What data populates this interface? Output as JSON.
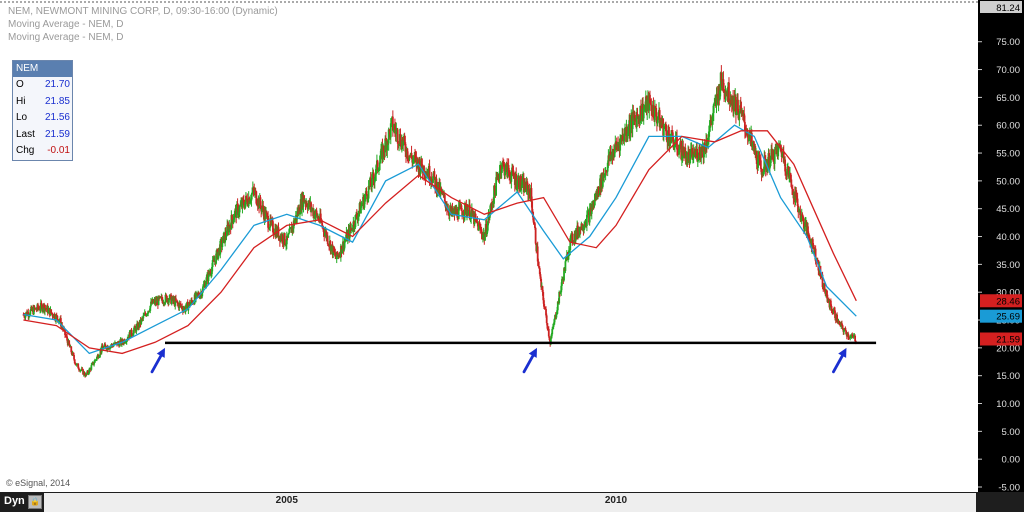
{
  "header": {
    "line1": "NEM, NEWMONT MINING CORP, D, 09:30-16:00 (Dynamic)",
    "line2": "Moving Average - NEM, D",
    "line3": "Moving Average - NEM, D"
  },
  "legend": {
    "symbol": "NEM",
    "rows": [
      {
        "label": "O",
        "value": "21.70"
      },
      {
        "label": "Hi",
        "value": "21.85"
      },
      {
        "label": "Lo",
        "value": "21.56"
      },
      {
        "label": "Last",
        "value": "21.59"
      },
      {
        "label": "Chg",
        "value": "-0.01"
      }
    ]
  },
  "copyright": "© eSignal, 2014",
  "bottom": {
    "mode": "Dyn",
    "lock_icon": "lock-icon"
  },
  "colors": {
    "up_candle": "#22aa22",
    "down_candle": "#cc2222",
    "ma_fast": "#1a9bd6",
    "ma_slow": "#d42020",
    "arrow": "#1a2fd0",
    "support": "#000000",
    "axis_bg": "#000000"
  },
  "chart_data": {
    "type": "line",
    "x_labels": [
      "2005",
      "2010"
    ],
    "yticks": [
      "75.00",
      "70.00",
      "65.00",
      "60.00",
      "55.00",
      "50.00",
      "45.00",
      "40.00",
      "35.00",
      "30.00",
      "25.00",
      "20.00",
      "15.00",
      "10.00",
      "5.00",
      "0.00",
      "-5.00"
    ],
    "ylim": [
      -5.0,
      81.24
    ],
    "top_label": "81.24",
    "price_tags": [
      {
        "value": 28.46,
        "label": "28.46",
        "color": "#d42020"
      },
      {
        "value": 25.69,
        "label": "25.69",
        "color": "#1a9bd6"
      },
      {
        "value": 21.59,
        "label": "21.59",
        "color": "#d42020"
      }
    ],
    "support_level": 20.9,
    "support_range": [
      2003.15,
      2013.95
    ],
    "arrows_at": [
      2003.15,
      2008.8,
      2013.5
    ],
    "series": [
      {
        "name": "NEM",
        "x": [
          2001.0,
          2001.3,
          2001.55,
          2001.8,
          2001.95,
          2002.2,
          2002.5,
          2002.75,
          2002.95,
          2003.2,
          2003.45,
          2003.7,
          2003.95,
          2004.2,
          2004.5,
          2004.75,
          2005.0,
          2005.25,
          2005.5,
          2005.75,
          2006.0,
          2006.3,
          2006.6,
          2006.9,
          2007.2,
          2007.5,
          2007.75,
          2008.0,
          2008.25,
          2008.5,
          2008.7,
          2008.85,
          2009.0,
          2009.3,
          2009.6,
          2009.9,
          2010.2,
          2010.5,
          2010.8,
          2011.1,
          2011.35,
          2011.6,
          2011.9,
          2012.2,
          2012.5,
          2012.8,
          2013.0,
          2013.2,
          2013.4,
          2013.55,
          2013.65
        ],
        "values": [
          26,
          27.5,
          25,
          17,
          15,
          20,
          21,
          24,
          28,
          29,
          27,
          30,
          37,
          44,
          48,
          42,
          39,
          47,
          43,
          36,
          42,
          50,
          60,
          54,
          51,
          44,
          45,
          40,
          53,
          50,
          48,
          32,
          21,
          39,
          44,
          54,
          60,
          64,
          58,
          54,
          56,
          68,
          62,
          52,
          56,
          44,
          38,
          29,
          24,
          22,
          21.59
        ]
      },
      {
        "name": "",
        "x": [
          2001.0,
          2001.5,
          2002.0,
          2002.5,
          2003.0,
          2003.5,
          2004.0,
          2004.5,
          2005.0,
          2005.5,
          2006.0,
          2006.5,
          2007.0,
          2007.5,
          2008.0,
          2008.5,
          2008.9,
          2009.2,
          2009.6,
          2010.0,
          2010.5,
          2011.0,
          2011.4,
          2011.8,
          2012.1,
          2012.5,
          2012.9,
          2013.2,
          2013.65
        ],
        "values": [
          26,
          25,
          19,
          21,
          24,
          27,
          34,
          42,
          44,
          42,
          39,
          50,
          53,
          44,
          43,
          48,
          41,
          36,
          40,
          47,
          58,
          58,
          56,
          60,
          58,
          47,
          40,
          31,
          25.69
        ]
      },
      {
        "name": "",
        "x": [
          2001.0,
          2001.5,
          2002.0,
          2002.5,
          2003.0,
          2003.5,
          2004.0,
          2004.5,
          2005.0,
          2005.5,
          2006.0,
          2006.5,
          2007.0,
          2007.5,
          2008.0,
          2008.5,
          2008.9,
          2009.3,
          2009.7,
          2010.0,
          2010.5,
          2011.0,
          2011.5,
          2011.9,
          2012.3,
          2012.7,
          2013.0,
          2013.3,
          2013.65
        ],
        "values": [
          25,
          24,
          20,
          19,
          21,
          24,
          30,
          38,
          42,
          43,
          40,
          46,
          51,
          47,
          44,
          46,
          47,
          39,
          38,
          42,
          52,
          58,
          57,
          59,
          59,
          53,
          45,
          37,
          28.46
        ]
      }
    ]
  }
}
